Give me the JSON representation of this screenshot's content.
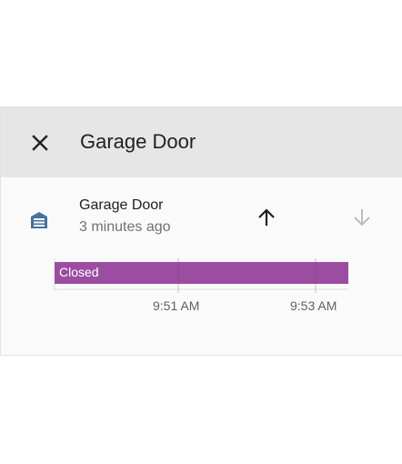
{
  "dialog": {
    "title": "Garage Door",
    "close_icon": "close-icon"
  },
  "entity": {
    "name": "Garage Door",
    "last_changed": "3 minutes ago",
    "icon": "garage-icon",
    "open_icon": "arrow-up-icon",
    "close_icon": "arrow-down-icon"
  },
  "history": {
    "state_label": "Closed",
    "state_color": "#9b4ea1",
    "ticks": [
      "9:51 AM",
      "9:53 AM"
    ]
  },
  "colors": {
    "header_bg": "#e6e6e6",
    "icon": "#44739e",
    "closed_state": "#9b4ea1"
  }
}
